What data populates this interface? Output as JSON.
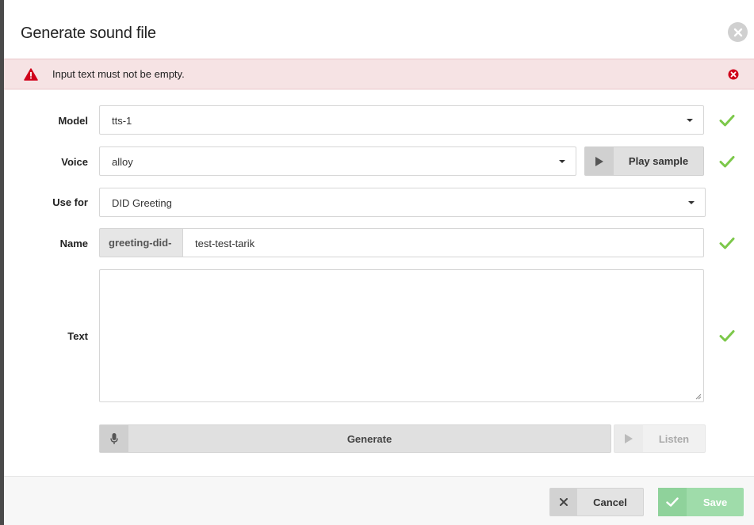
{
  "dialog": {
    "title": "Generate sound file"
  },
  "alert": {
    "message": "Input text must not be empty."
  },
  "form": {
    "model": {
      "label": "Model",
      "value": "tts-1"
    },
    "voice": {
      "label": "Voice",
      "value": "alloy",
      "play_sample_label": "Play sample"
    },
    "use_for": {
      "label": "Use for",
      "value": "DID Greeting"
    },
    "name": {
      "label": "Name",
      "prefix": "greeting-did-",
      "value": "test-test-tarik"
    },
    "text": {
      "label": "Text",
      "value": ""
    }
  },
  "actions": {
    "generate_label": "Generate",
    "listen_label": "Listen"
  },
  "footer": {
    "cancel_label": "Cancel",
    "save_label": "Save"
  },
  "colors": {
    "success": "#7cc84a",
    "error": "#d0021b",
    "alert_bg": "#f6e3e4",
    "save_bg": "#9fdcaa"
  },
  "icons": {
    "close": "close-circle-icon",
    "warning": "warning-triangle-icon",
    "error_close": "error-circle-icon",
    "valid": "checkmark-icon",
    "play": "play-icon",
    "mic": "microphone-icon",
    "cancel": "x-icon"
  }
}
